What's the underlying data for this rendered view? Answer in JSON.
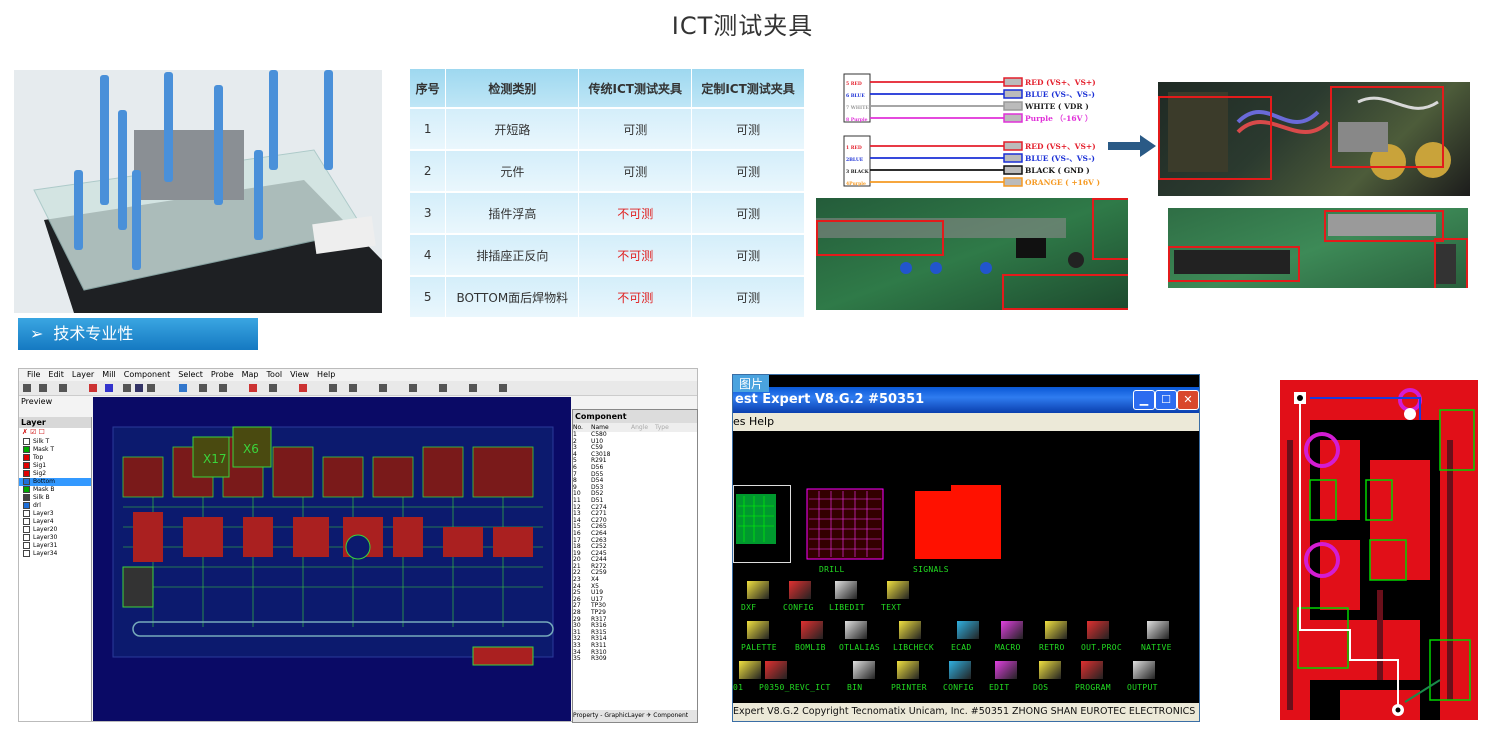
{
  "page": {
    "title": "ICT测试夹具"
  },
  "compare_table": {
    "headers": [
      "序号",
      "检测类别",
      "传统ICT测试夹具",
      "定制ICT测试夹具"
    ],
    "rows": [
      {
        "no": "1",
        "category": "开短路",
        "traditional": "可测",
        "custom": "可测",
        "traditional_bad": false
      },
      {
        "no": "2",
        "category": "元件",
        "traditional": "可测",
        "custom": "可测",
        "traditional_bad": false
      },
      {
        "no": "3",
        "category": "插件浮高",
        "traditional": "不可测",
        "custom": "可测",
        "traditional_bad": true
      },
      {
        "no": "4",
        "category": "排插座正反向",
        "traditional": "不可测",
        "custom": "可测",
        "traditional_bad": true
      },
      {
        "no": "5",
        "category": "BOTTOM面后焊物料",
        "traditional": "不可测",
        "custom": "可测",
        "traditional_bad": true
      }
    ]
  },
  "wiring": {
    "group1_left": [
      "5 RED",
      "6 BLUE",
      "7 WHITE",
      "8 Purple"
    ],
    "group1_right": [
      "RED (VS+、VS+)",
      "BLUE (VS-、VS-)",
      "WHITE ( VDR )",
      "Purple （-16V ）"
    ],
    "group2_left": [
      "1 RED",
      "2BLUE",
      "3 BLACK",
      "4Purple"
    ],
    "group2_right": [
      "RED (VS+、VS+)",
      "BLUE (VS-、VS-)",
      "BLACK ( GND )",
      "ORANGE ( +16V )"
    ],
    "colors": [
      "#e41e2b",
      "#1a2fd6",
      "#9a9a9a",
      "#e030d8",
      "#e41e2b",
      "#1a2fd6",
      "#111111",
      "#f59a23"
    ]
  },
  "section": {
    "banner": "技术专业性",
    "arrow": "➢"
  },
  "cam": {
    "menu": [
      "File",
      "Edit",
      "Layer",
      "Mill",
      "Component",
      "Select",
      "Probe",
      "Map",
      "Tool",
      "View",
      "Help"
    ],
    "preview_label": "Preview",
    "layer_header": "Layer",
    "layers": [
      {
        "name": "Silk T",
        "color": "#ffffff"
      },
      {
        "name": "Mask T",
        "color": "#00aa00"
      },
      {
        "name": "Top",
        "color": "#e00000"
      },
      {
        "name": "Sig1",
        "color": "#e00000"
      },
      {
        "name": "Sig2",
        "color": "#e00000"
      },
      {
        "name": "Bottom",
        "color": "#1e6fd9"
      },
      {
        "name": "Mask B",
        "color": "#00aa00"
      },
      {
        "name": "Silk B",
        "color": "#444444"
      },
      {
        "name": "drl",
        "color": "#1e6fd9"
      },
      {
        "name": "Layer3",
        "color": "#ffffff"
      },
      {
        "name": "Layer4",
        "color": "#ffffff"
      },
      {
        "name": "Layer20",
        "color": "#ffffff"
      },
      {
        "name": "Layer30",
        "color": "#ffffff"
      },
      {
        "name": "Layer31",
        "color": "#ffffff"
      },
      {
        "name": "Layer34",
        "color": "#ffffff"
      }
    ],
    "component_header": "Component",
    "component_columns": [
      "No.",
      "Name",
      "Angle",
      "Type"
    ],
    "components": [
      "C580",
      "U10",
      "C59",
      "C3018",
      "R291",
      "D56",
      "D55",
      "D54",
      "D53",
      "D52",
      "D51",
      "C274",
      "C271",
      "C270",
      "C265",
      "C264",
      "C263",
      "C252",
      "C245",
      "C244",
      "R272",
      "C259",
      "X4",
      "X5",
      "U19",
      "U17",
      "TP30",
      "TP29",
      "R317",
      "R316",
      "R315",
      "R314",
      "R311",
      "R310",
      "R309"
    ],
    "tabs": "Property - GraphicLayer  ✈ Component"
  },
  "test_expert": {
    "badge": "图片",
    "title": "est Expert V8.G.2  #50351",
    "menu": "es   Help",
    "previews": [
      "DRILL",
      "SIGNALS"
    ],
    "row1": [
      "DXF",
      "CONFIG",
      "LIBEDIT",
      "TEXT"
    ],
    "row2": [
      "PALETTE",
      "BOMLIB",
      "OTLALIAS",
      "LIBCHECK",
      "ECAD",
      "MACRO",
      "RETRO",
      "OUT.PROC",
      "NATIVE"
    ],
    "row3": [
      "01",
      "P0350_REVC_ICT",
      "BIN",
      "PRINTER",
      "CONFIG",
      "EDIT",
      "DOS",
      "PROGRAM",
      "OUTPUT"
    ],
    "status": "Expert V8.G.2   Copyright Tecnomatix Unicam, Inc.  #50351  ZHONG SHAN EUROTEC ELECTRONICS LTD,"
  }
}
